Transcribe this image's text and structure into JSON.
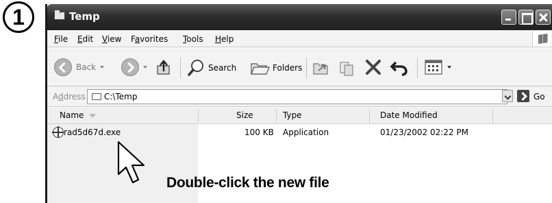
{
  "step": {
    "number": "1"
  },
  "window": {
    "title": "Temp",
    "title_icon": "folder-icon",
    "controls": [
      "minimize",
      "maximize",
      "close"
    ]
  },
  "menu": {
    "items": [
      {
        "accel": "F",
        "rest": "ile"
      },
      {
        "accel": "E",
        "rest": "dit"
      },
      {
        "accel": "V",
        "rest": "iew"
      },
      {
        "pre": "F",
        "accel": "a",
        "rest": "vorites"
      },
      {
        "accel": "T",
        "rest": "ools"
      },
      {
        "accel": "H",
        "rest": "elp"
      }
    ]
  },
  "toolbar": {
    "back_label": "Back",
    "search_label": "Search",
    "folders_label": "Folders",
    "icons": [
      "back-icon",
      "forward-icon",
      "up-folder-icon",
      "search-icon",
      "folders-icon",
      "move-to-icon",
      "copy-to-icon",
      "delete-icon",
      "undo-icon",
      "views-icon"
    ]
  },
  "address": {
    "label_pre": "A",
    "label_accel": "d",
    "label_rest": "dress",
    "value": "C:\\Temp",
    "go_label": "Go"
  },
  "columns": {
    "name": "Name",
    "size": "Size",
    "type": "Type",
    "date": "Date Modified"
  },
  "files": [
    {
      "name": "rad5d67d.exe",
      "size": "100 KB",
      "type": "Application",
      "date": "01/23/2002 02:22 PM"
    }
  ],
  "instruction": "Double-click the new file",
  "colors": {
    "titlebar": "#2e2e2e",
    "chrome": "#f3f3f3",
    "text": "#000000"
  }
}
